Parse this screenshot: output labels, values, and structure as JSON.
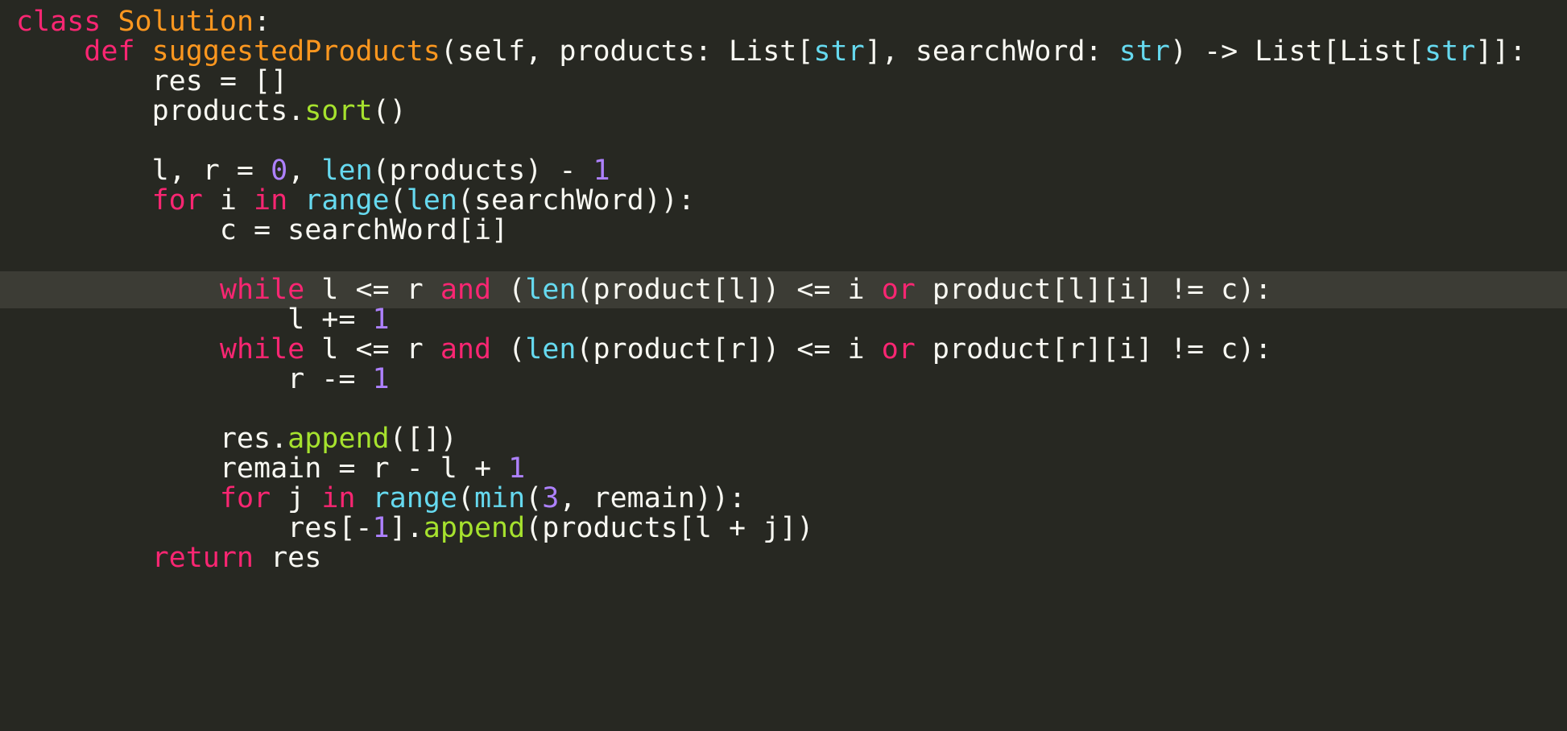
{
  "editor": {
    "language": "python",
    "theme_colors": {
      "background": "#272822",
      "current_line": "#3c3c35",
      "keyword": "#f92672",
      "function_name": "#fd971f",
      "builtin": "#66d9ef",
      "method_call": "#a6e22e",
      "number": "#ae81ff",
      "text": "#f8f8f2"
    },
    "highlighted_line": 9,
    "lines": [
      [
        {
          "t": "class ",
          "c": "kw"
        },
        {
          "t": "Solution",
          "c": "cls"
        },
        {
          "t": ":",
          "c": "plain"
        }
      ],
      [
        {
          "t": "    ",
          "c": "plain"
        },
        {
          "t": "def ",
          "c": "kw"
        },
        {
          "t": "suggestedProducts",
          "c": "fn"
        },
        {
          "t": "(self, products: List[",
          "c": "plain"
        },
        {
          "t": "str",
          "c": "ty"
        },
        {
          "t": "], searchWord: ",
          "c": "plain"
        },
        {
          "t": "str",
          "c": "ty"
        },
        {
          "t": ") -> List[List[",
          "c": "plain"
        },
        {
          "t": "str",
          "c": "ty"
        },
        {
          "t": "]]:",
          "c": "plain"
        }
      ],
      [
        {
          "t": "        res = []",
          "c": "plain"
        }
      ],
      [
        {
          "t": "        products.",
          "c": "plain"
        },
        {
          "t": "sort",
          "c": "call"
        },
        {
          "t": "()",
          "c": "plain"
        }
      ],
      [
        {
          "t": "",
          "c": "plain"
        }
      ],
      [
        {
          "t": "        l, r = ",
          "c": "plain"
        },
        {
          "t": "0",
          "c": "num"
        },
        {
          "t": ", ",
          "c": "plain"
        },
        {
          "t": "len",
          "c": "bi"
        },
        {
          "t": "(products) - ",
          "c": "plain"
        },
        {
          "t": "1",
          "c": "num"
        }
      ],
      [
        {
          "t": "        ",
          "c": "plain"
        },
        {
          "t": "for",
          "c": "kw"
        },
        {
          "t": " i ",
          "c": "plain"
        },
        {
          "t": "in",
          "c": "kw"
        },
        {
          "t": " ",
          "c": "plain"
        },
        {
          "t": "range",
          "c": "bi"
        },
        {
          "t": "(",
          "c": "plain"
        },
        {
          "t": "len",
          "c": "bi"
        },
        {
          "t": "(searchWord)):",
          "c": "plain"
        }
      ],
      [
        {
          "t": "            c = searchWord[i]",
          "c": "plain"
        }
      ],
      [
        {
          "t": "",
          "c": "plain"
        }
      ],
      [
        {
          "t": "            ",
          "c": "plain"
        },
        {
          "t": "while",
          "c": "kw"
        },
        {
          "t": " l <= r ",
          "c": "plain"
        },
        {
          "t": "and",
          "c": "kw"
        },
        {
          "t": " (",
          "c": "plain"
        },
        {
          "t": "len",
          "c": "bi"
        },
        {
          "t": "(product[l]) <= i ",
          "c": "plain"
        },
        {
          "t": "or",
          "c": "kw"
        },
        {
          "t": " product[l][i] != c):",
          "c": "plain"
        }
      ],
      [
        {
          "t": "                l += ",
          "c": "plain"
        },
        {
          "t": "1",
          "c": "num"
        }
      ],
      [
        {
          "t": "            ",
          "c": "plain"
        },
        {
          "t": "while",
          "c": "kw"
        },
        {
          "t": " l <= r ",
          "c": "plain"
        },
        {
          "t": "and",
          "c": "kw"
        },
        {
          "t": " (",
          "c": "plain"
        },
        {
          "t": "len",
          "c": "bi"
        },
        {
          "t": "(product[r]) <= i ",
          "c": "plain"
        },
        {
          "t": "or",
          "c": "kw"
        },
        {
          "t": " product[r][i] != c):",
          "c": "plain"
        }
      ],
      [
        {
          "t": "                r -= ",
          "c": "plain"
        },
        {
          "t": "1",
          "c": "num"
        }
      ],
      [
        {
          "t": "",
          "c": "plain"
        }
      ],
      [
        {
          "t": "            res.",
          "c": "plain"
        },
        {
          "t": "append",
          "c": "call"
        },
        {
          "t": "([])",
          "c": "plain"
        }
      ],
      [
        {
          "t": "            remain = r - l + ",
          "c": "plain"
        },
        {
          "t": "1",
          "c": "num"
        }
      ],
      [
        {
          "t": "            ",
          "c": "plain"
        },
        {
          "t": "for",
          "c": "kw"
        },
        {
          "t": " j ",
          "c": "plain"
        },
        {
          "t": "in",
          "c": "kw"
        },
        {
          "t": " ",
          "c": "plain"
        },
        {
          "t": "range",
          "c": "bi"
        },
        {
          "t": "(",
          "c": "plain"
        },
        {
          "t": "min",
          "c": "bi"
        },
        {
          "t": "(",
          "c": "plain"
        },
        {
          "t": "3",
          "c": "num"
        },
        {
          "t": ", remain)):",
          "c": "plain"
        }
      ],
      [
        {
          "t": "                res[-",
          "c": "plain"
        },
        {
          "t": "1",
          "c": "num"
        },
        {
          "t": "].",
          "c": "plain"
        },
        {
          "t": "append",
          "c": "call"
        },
        {
          "t": "(products[l + j])",
          "c": "plain"
        }
      ],
      [
        {
          "t": "        ",
          "c": "plain"
        },
        {
          "t": "return",
          "c": "kw"
        },
        {
          "t": " res",
          "c": "plain"
        }
      ]
    ]
  }
}
